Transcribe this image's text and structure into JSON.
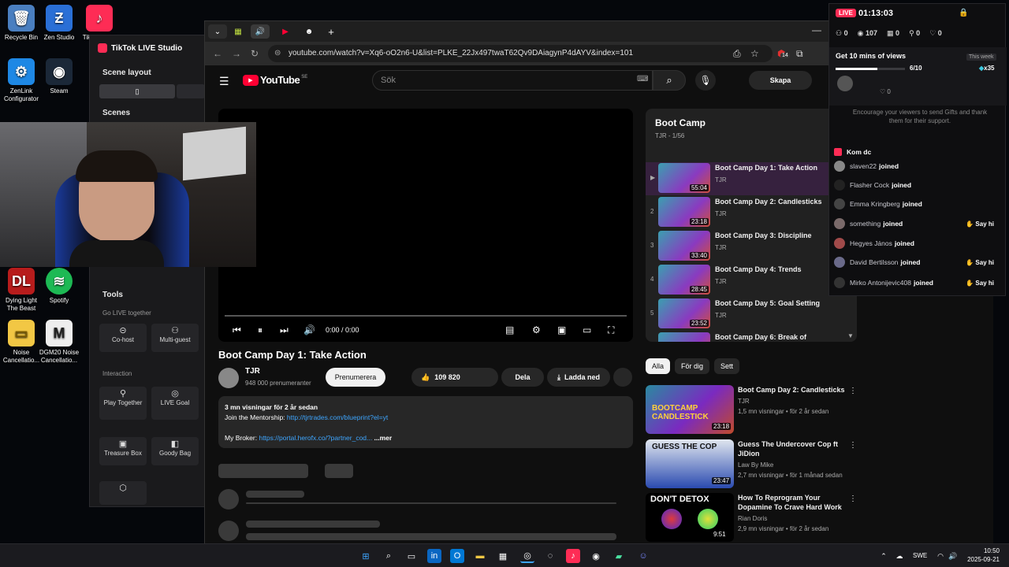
{
  "desktop": {
    "icons": [
      {
        "label": "Recycle Bin",
        "icon": "recycle-bin-icon",
        "color": "#5a8fd0"
      },
      {
        "label": "Zen Studio",
        "icon": "zen-icon",
        "color": "#2a6fd6"
      },
      {
        "label": "TikTok LIVE",
        "icon": "tiktok-icon",
        "color": "#fe2c55"
      },
      {
        "label": "ZenLink Configurator",
        "icon": "zenlink-icon",
        "color": "#1e88e5"
      },
      {
        "label": "Steam",
        "icon": "steam-icon",
        "color": "#1b2838"
      },
      {
        "label": "Dying Light The Beast",
        "icon": "dying-light-icon",
        "color": "#b71c1c"
      },
      {
        "label": "Spotify",
        "icon": "spotify-icon",
        "color": "#1db954"
      },
      {
        "label": "Noise Cancellatio...",
        "icon": "folder-icon",
        "color": "#f2c744"
      },
      {
        "label": "DGM20 Noise Cancellatio...",
        "icon": "dgm-icon",
        "color": "#eeeeee"
      }
    ]
  },
  "studio": {
    "title": "TikTok LIVE Studio",
    "scene_layout": "Scene layout",
    "scenes": "Scenes",
    "tools": "Tools",
    "go_live_together": "Go LIVE together",
    "cohost": "Co-host",
    "multiguest": "Multi-guest",
    "interaction": "Interaction",
    "play_together": "Play Together",
    "live_goal": "LIVE Goal",
    "treasure_box": "Treasure Box",
    "goody_bag": "Goody Bag"
  },
  "browser": {
    "url": "youtube.com/watch?v=Xq6-oO2n6-U&list=PLKE_22Jx497twaT62Qv9DAiagynP4dAYV&index=101",
    "ext_badge": "14"
  },
  "youtube": {
    "logo": "YouTube",
    "region": "SE",
    "search_placeholder": "Sök",
    "create": "Skapa",
    "player_time": "0:00 / 0:00",
    "video_title": "Boot Camp Day 1: Take Action",
    "channel": "TJR",
    "subscribers": "948 000 prenumeranter",
    "subscribe": "Prenumerera",
    "likes": "109 820",
    "share": "Dela",
    "download": "Ladda ned",
    "desc_meta": "3 mn visningar  för 2 år sedan",
    "desc_line1": "Join the Mentorship:",
    "desc_link1": "http://tjrtrades.com/blueprint?el=yt",
    "desc_line2": "My Broker:",
    "desc_link2": "https://portal.herofx.co/?partner_cod...",
    "more": "...mer",
    "playlist": {
      "title": "Boot Camp",
      "meta": "TJR - 1/56",
      "items": [
        {
          "num": "▶",
          "title": "Boot Camp Day 1: Take Action",
          "channel": "TJR",
          "duration": "55:04"
        },
        {
          "num": "2",
          "title": "Boot Camp Day 2: Candlesticks",
          "channel": "TJR",
          "duration": "23:18"
        },
        {
          "num": "3",
          "title": "Boot Camp Day 3: Discipline",
          "channel": "TJR",
          "duration": "33:40"
        },
        {
          "num": "4",
          "title": "Boot Camp Day 4: Trends",
          "channel": "TJR",
          "duration": "28:45"
        },
        {
          "num": "5",
          "title": "Boot Camp Day 5: Goal Setting",
          "channel": "TJR",
          "duration": "23:52"
        },
        {
          "num": "",
          "title": "Boot Camp Day 6: Break of",
          "channel": "",
          "duration": ""
        }
      ]
    },
    "chips": [
      "Alla",
      "För dig",
      "Sett"
    ],
    "recommendations": [
      {
        "title": "Boot Camp Day 2: Candlesticks",
        "channel": "TJR",
        "meta": "1,5 mn visningar  •  för 2 år sedan",
        "duration": "23:18",
        "thumb_text": "BOOTCAMP CANDLESTICK"
      },
      {
        "title": "Guess The Undercover Cop ft JiDion",
        "channel": "Law By Mike",
        "meta": "2,7 mn visningar  •  för 1 månad sedan",
        "duration": "23:47",
        "thumb_text": "GUESS THE COP"
      },
      {
        "title": "How To Reprogram Your Dopamine To Crave Hard Work",
        "channel": "Rian Doris",
        "meta": "2,9 mn visningar  •  för 2 år sedan",
        "duration": "9:51",
        "thumb_text": "DON'T DETOX"
      }
    ]
  },
  "live_panel": {
    "live_badge": "LIVE",
    "timer": "01:13:03",
    "stats": [
      "0",
      "107",
      "0",
      "0",
      "0"
    ],
    "goal_title": "Get 10 mins of views",
    "this_week": "This week",
    "goal_progress": "6/10",
    "goal_progress_fraction": 0.6,
    "reward": "x35",
    "likes_count": "0",
    "encourage": "Encourage your viewers to send Gifts and thank them for their support.",
    "comment_user": "Kom dc",
    "joined_label": "joined",
    "say_hi": "Say hi",
    "joins": [
      {
        "name": "slaven22",
        "sayhi": false
      },
      {
        "name": "Flasher Cock",
        "sayhi": false
      },
      {
        "name": "Emma Kringberg",
        "sayhi": false
      },
      {
        "name": "something",
        "sayhi": true
      },
      {
        "name": "Hegyes János",
        "sayhi": false
      },
      {
        "name": "David Bertilsson",
        "sayhi": true
      },
      {
        "name": "Mirko Antonijevic408",
        "sayhi": true
      }
    ]
  },
  "taskbar": {
    "lang": "SWE",
    "time": "10:50",
    "date": "2025-09-21"
  }
}
